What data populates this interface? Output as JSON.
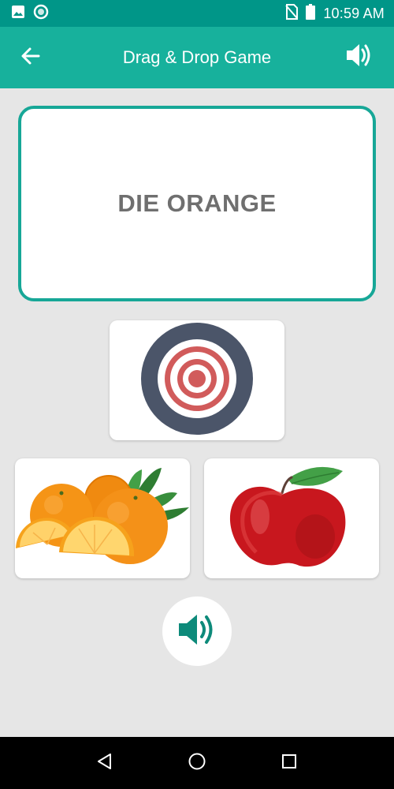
{
  "status_bar": {
    "time": "10:59 AM",
    "icons_left": [
      "image-icon",
      "sync-icon"
    ],
    "icons_right": [
      "no-sim-icon",
      "battery-icon"
    ]
  },
  "app_bar": {
    "title": "Drag & Drop Game",
    "back_icon": "arrow-left-icon",
    "sound_icon": "volume-icon",
    "background": "#17b19c"
  },
  "word_card": {
    "word": "DIE ORANGE",
    "border_color": "#17a797"
  },
  "drop_target": {
    "icon": "target-icon"
  },
  "options": [
    {
      "name": "orange",
      "icon": "orange-fruit-image"
    },
    {
      "name": "apple",
      "icon": "apple-fruit-image"
    }
  ],
  "sound_button": {
    "icon": "volume-icon",
    "color": "#0d8a7a"
  },
  "nav_bar": {
    "buttons": [
      "back-triangle-icon",
      "home-circle-icon",
      "recents-square-icon"
    ]
  },
  "colors": {
    "status_bar": "#009688",
    "accent": "#17b19c",
    "background": "#e6e6e6"
  }
}
